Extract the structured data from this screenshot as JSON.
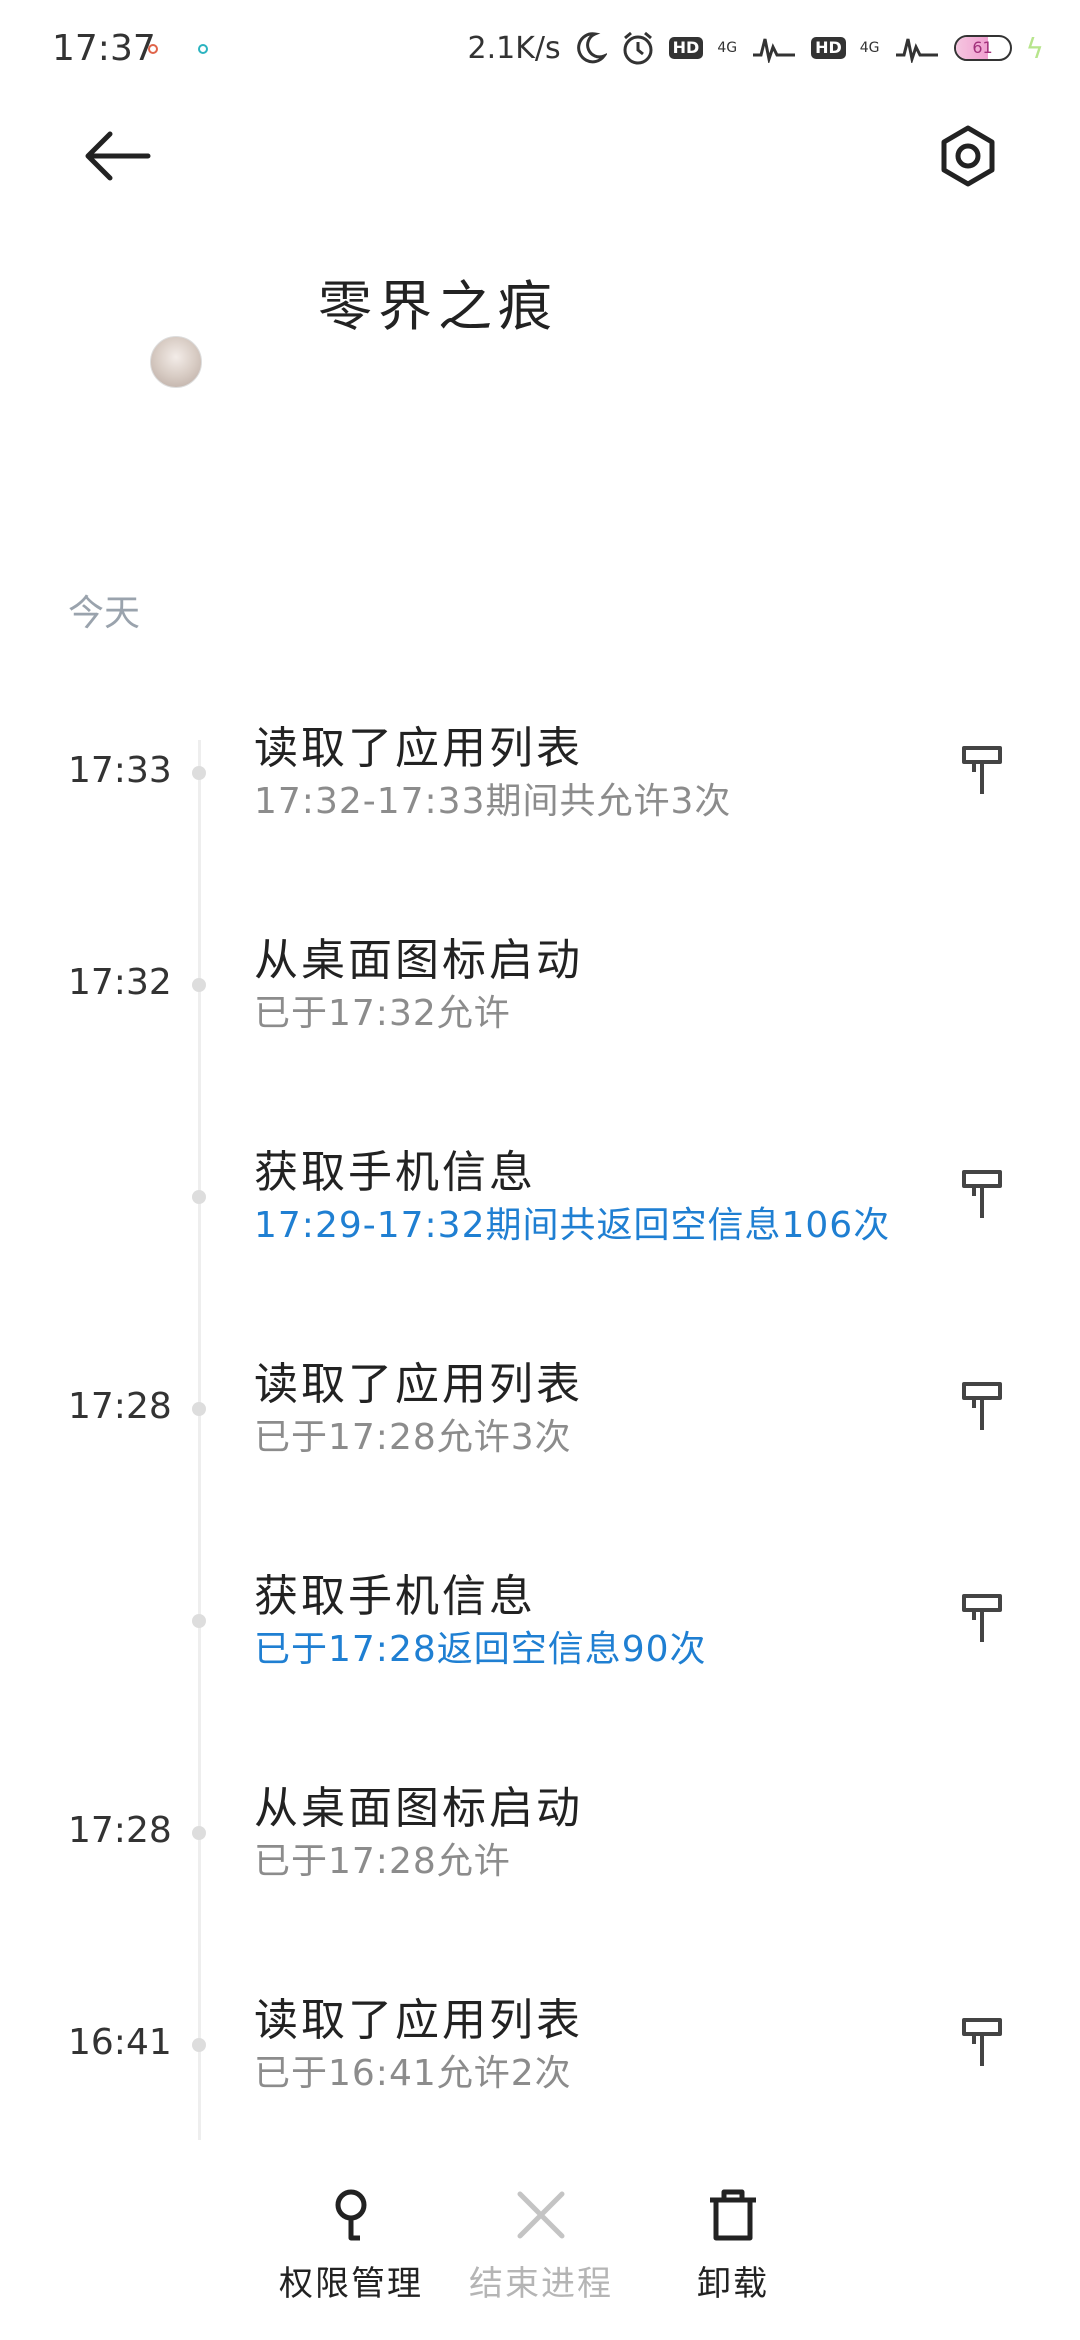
{
  "status_bar": {
    "time": "17:37",
    "net_speed": "2.1K/s",
    "hd1": "HD",
    "hd2": "HD",
    "net1": "4G",
    "net2": "4G",
    "battery": "61",
    "battery_level": 0.61
  },
  "header": {
    "app_name": "零界之痕"
  },
  "section_label": "今天",
  "timeline": [
    {
      "time": "17:33",
      "title": "读取了应用列表",
      "subtitle": "17:32-17:33期间共允许3次",
      "subtitle_style": "gray",
      "has_pin": true
    },
    {
      "time": "17:32",
      "title": "从桌面图标启动",
      "subtitle": "已于17:32允许",
      "subtitle_style": "gray",
      "has_pin": false
    },
    {
      "time": "",
      "title": "获取手机信息",
      "subtitle": "17:29-17:32期间共返回空信息106次",
      "subtitle_style": "blue",
      "has_pin": true
    },
    {
      "time": "17:28",
      "title": "读取了应用列表",
      "subtitle": "已于17:28允许3次",
      "subtitle_style": "gray",
      "has_pin": true
    },
    {
      "time": "",
      "title": "获取手机信息",
      "subtitle": "已于17:28返回空信息90次",
      "subtitle_style": "blue",
      "has_pin": true
    },
    {
      "time": "17:28",
      "title": "从桌面图标启动",
      "subtitle": "已于17:28允许",
      "subtitle_style": "gray",
      "has_pin": false
    },
    {
      "time": "16:41",
      "title": "读取了应用列表",
      "subtitle": "已于16:41允许2次",
      "subtitle_style": "gray",
      "has_pin": true
    }
  ],
  "bottom_bar": {
    "permissions_label": "权限管理",
    "end_process_label": "结束进程",
    "uninstall_label": "卸载"
  },
  "colors": {
    "accent_blue": "#1f7fd2",
    "subtitle_gray": "#8c8c8c",
    "section_gray": "#9aa3ad"
  }
}
